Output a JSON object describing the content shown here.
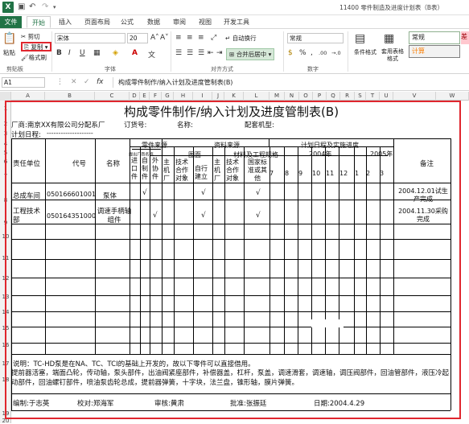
{
  "window": {
    "title": "11400 零件制造及进度计划表（B表）"
  },
  "qat": {
    "save": "💾",
    "undo": "↶",
    "redo": "↷"
  },
  "tabs": [
    {
      "label": "文件"
    },
    {
      "label": "开始"
    },
    {
      "label": "插入"
    },
    {
      "label": "页面布局"
    },
    {
      "label": "公式"
    },
    {
      "label": "数据"
    },
    {
      "label": "审阅"
    },
    {
      "label": "视图"
    },
    {
      "label": "开发工具"
    }
  ],
  "ribbon": {
    "clipboard": {
      "paste": "粘贴",
      "cut": "剪切",
      "copy": "复制",
      "format_painter": "格式刷",
      "label": "剪贴板"
    },
    "font": {
      "name": "宋体",
      "size": "20",
      "bold": "B",
      "italic": "I",
      "underline": "U",
      "grow": "A˄",
      "shrink": "A˅",
      "label": "字体",
      "wen": "文"
    },
    "align": {
      "wrap": "自动换行",
      "merge": "合并后居中",
      "label": "对齐方式"
    },
    "number": {
      "format": "常规",
      "label": "数字",
      "percent": "%",
      "comma": ",",
      "dec_inc": ".00",
      "dec_dec": "→.0"
    },
    "styles": {
      "conditional": "条件格式",
      "table": "套用表格格式",
      "normal": "常规",
      "bad": "差",
      "calc": "计算"
    }
  },
  "formula_bar": {
    "cell_ref": "A1",
    "fx": "fx",
    "content": "构成零件制作/纳入计划及进度管制表(B)"
  },
  "columns": [
    "A",
    "B",
    "C",
    "D",
    "E",
    "F",
    "G",
    "H",
    "I",
    "J",
    "K",
    "L",
    "M",
    "N",
    "O",
    "P",
    "Q",
    "R",
    "S",
    "T",
    "U",
    "V",
    "W"
  ],
  "rows": [
    "1",
    "2",
    "3",
    "4",
    "5",
    "6",
    "7",
    "8",
    "9",
    "10",
    "11",
    "12",
    "13",
    "14",
    "15",
    "16",
    "17",
    "18",
    "19",
    "20"
  ],
  "sheet": {
    "title": "构成零件制作/纳入计划及进度管制表(B)",
    "factory": "厂商:南京XX有限公司分配系厂",
    "order_no": "订货号:",
    "name_lbl": "名称:",
    "kit_model": "配套机型:",
    "plan_date": "计划日程:",
    "plan_date_dash": "--------------------",
    "hdr": {
      "unit": "责任单位",
      "code": "代号",
      "name": "名称",
      "parts_src": "零件来源",
      "self_mfg": "提出厂商名称",
      "entry": "进口件",
      "own": "自制件",
      "outsource": "外协件",
      "data_src": "资料来源",
      "drawing": "图面",
      "mat_std": "材料及工程规格",
      "main_factory": "主机厂",
      "tech_coop": "技术合作对象",
      "self_built": "自行建立",
      "main_factory2": "主机厂",
      "tech_coop2": "技术合作对象",
      "national": "国家标准或其他",
      "schedule": "计划日程及实施进度",
      "y2004": "2004年",
      "y2005": "2005年",
      "remark": "备注",
      "months": [
        "7",
        "8",
        "9",
        "10",
        "11",
        "12",
        "1",
        "2",
        "3"
      ]
    },
    "rows": [
      {
        "unit": "总成车间",
        "code": "050166601001",
        "name": "泵体",
        "check1": "√",
        "check2": "√",
        "check3": "√",
        "remark": "2004.12.01试生产完成"
      },
      {
        "unit": "工程技术部",
        "code": "050164351000",
        "name": "调速手柄轴组件",
        "check1": "√",
        "check2": "√",
        "check3": "√",
        "remark": "2004.11.30采购完成"
      }
    ],
    "note1": "说明：TC-HD泵是在NA、TC、TCI的基础上开发的，故以下零件可以直接借用。",
    "note2": "提前器活塞，端面凸轮，传动轴，泵头部件，出油阀紧座部件，补偿器盖，杠杆，泵盖，调速滑套，调速轴，调压阀部件，回油管部件，液压冷起动部件，回油螺钉部件，喷油泵齿轮总成，提前器弹簧，十字块，法兰盘，锥形轴，膜片弹簧。",
    "compiler": "编制:于志英",
    "checker": "校对:郑海军",
    "reviewer": "审核:黄肃",
    "approver": "批准:张振廷",
    "date": "日期:2004.4.29"
  }
}
